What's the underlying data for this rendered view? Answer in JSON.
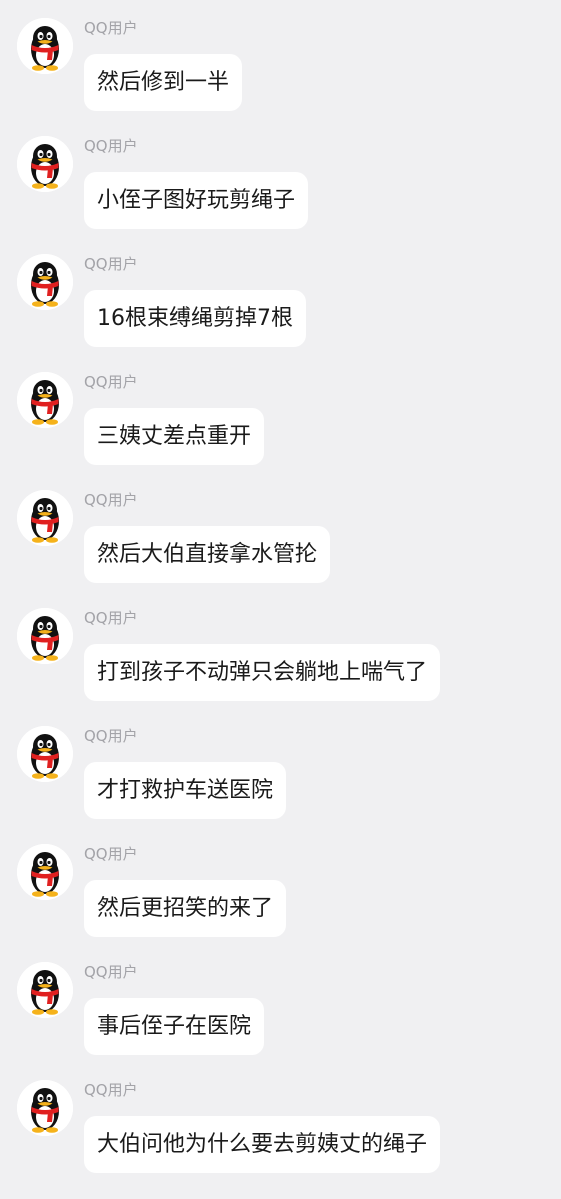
{
  "messages": [
    {
      "sender": "QQ用户",
      "text": "然后修到一半"
    },
    {
      "sender": "QQ用户",
      "text": "小侄子图好玩剪绳子"
    },
    {
      "sender": "QQ用户",
      "text": "16根束缚绳剪掉7根"
    },
    {
      "sender": "QQ用户",
      "text": "三姨丈差点重开"
    },
    {
      "sender": "QQ用户",
      "text": "然后大伯直接拿水管抡"
    },
    {
      "sender": "QQ用户",
      "text": "打到孩子不动弹只会躺地上喘气了"
    },
    {
      "sender": "QQ用户",
      "text": "才打救护车送医院"
    },
    {
      "sender": "QQ用户",
      "text": "然后更招笑的来了"
    },
    {
      "sender": "QQ用户",
      "text": "事后侄子在医院"
    },
    {
      "sender": "QQ用户",
      "text": "大伯问他为什么要去剪姨丈的绳子"
    }
  ],
  "avatar_icon": "qq-penguin-icon",
  "colors": {
    "background": "#f0f0f2",
    "bubble": "#ffffff",
    "sender_name": "#a3a3a8",
    "message_text": "#1a1a1a",
    "scarf": "#e02020",
    "beak": "#f5b21b"
  }
}
